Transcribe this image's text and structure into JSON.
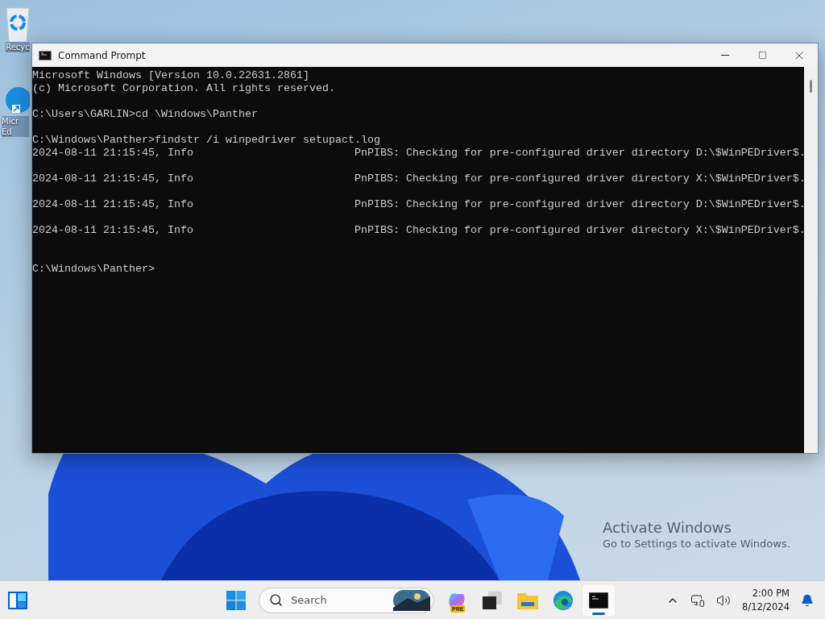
{
  "desktop_icons": [
    {
      "kind": "recycle",
      "label": "Recyc"
    },
    {
      "kind": "edge",
      "label": "Micr Ed"
    }
  ],
  "window": {
    "title": "Command Prompt",
    "active": true
  },
  "console": {
    "blocks": [
      [
        "Microsoft Windows [Version 10.0.22631.2861]",
        "(c) Microsoft Corporation. All rights reserved."
      ],
      [
        "C:\\Users\\GARLIN>cd \\Windows\\Panther"
      ],
      [
        "C:\\Windows\\Panther>findstr /i winpedriver setupact.log",
        "2024-08-11 21:15:45, Info                         PnPIBS: Checking for pre-configured driver directory D:\\$WinPEDriver$."
      ],
      [
        "2024-08-11 21:15:45, Info                         PnPIBS: Checking for pre-configured driver directory X:\\$WinPEDriver$."
      ],
      [
        "2024-08-11 21:15:45, Info                         PnPIBS: Checking for pre-configured driver directory D:\\$WinPEDriver$."
      ],
      [
        "2024-08-11 21:15:45, Info                         PnPIBS: Checking for pre-configured driver directory X:\\$WinPEDriver$."
      ]
    ],
    "prompt": "C:\\Windows\\Panther>"
  },
  "activation": {
    "title": "Activate Windows",
    "message": "Go to Settings to activate Windows."
  },
  "taskbar": {
    "search": {
      "placeholder": "Search"
    },
    "apps": [
      {
        "kind": "copilot",
        "badge": "PRE",
        "selected": false
      },
      {
        "kind": "taskview",
        "selected": false
      },
      {
        "kind": "explorer",
        "selected": false
      },
      {
        "kind": "edge",
        "selected": false
      },
      {
        "kind": "terminal",
        "selected": true
      }
    ],
    "time": "2:00 PM",
    "date": "8/12/2024"
  }
}
